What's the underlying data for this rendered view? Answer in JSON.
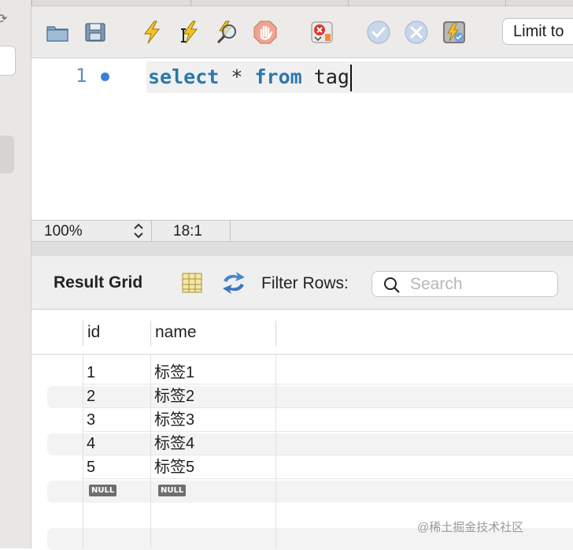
{
  "toolbar": {
    "icons": [
      "open-folder-icon",
      "save-icon",
      "execute-icon",
      "execute-current-icon",
      "explain-icon",
      "stop-icon",
      "toggle-error-icon",
      "commit-icon",
      "rollback-icon",
      "autocommit-icon"
    ],
    "limit_label": "Limit to"
  },
  "editor": {
    "line_number": "1",
    "code": {
      "kw1": "select",
      "op": "*",
      "kw2": "from",
      "table": "tag"
    }
  },
  "status": {
    "zoom": "100%",
    "cursor": "18:1"
  },
  "result": {
    "title": "Result Grid",
    "filter_label": "Filter Rows:",
    "search_placeholder": "Search",
    "columns": [
      "id",
      "name"
    ],
    "rows": [
      {
        "id": "1",
        "name": "标签1"
      },
      {
        "id": "2",
        "name": "标签2"
      },
      {
        "id": "3",
        "name": "标签3"
      },
      {
        "id": "4",
        "name": "标签4"
      },
      {
        "id": "5",
        "name": "标签5"
      },
      {
        "id": "NULL",
        "name": "NULL"
      }
    ]
  },
  "watermark": "@稀土掘金技术社区"
}
